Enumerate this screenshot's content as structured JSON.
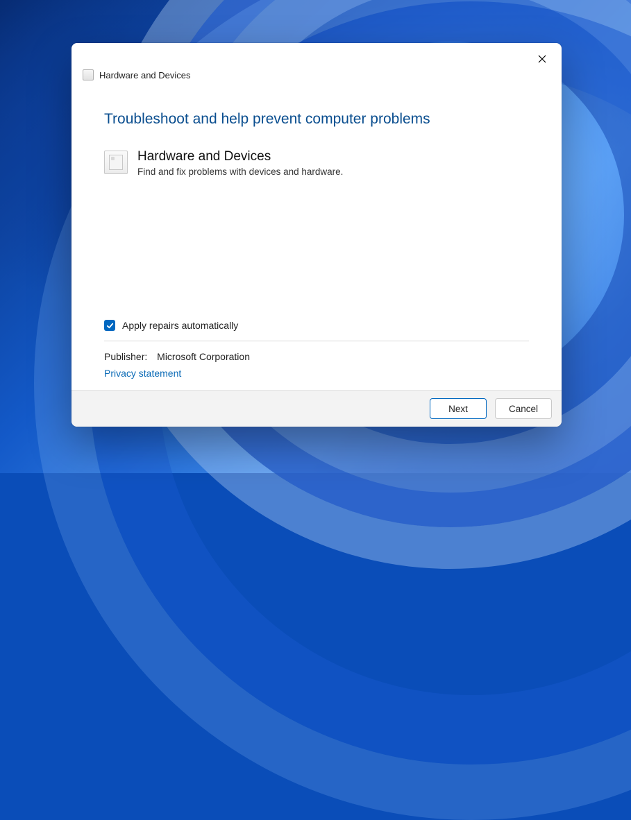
{
  "window": {
    "title": "Hardware and Devices"
  },
  "main": {
    "heading": "Troubleshoot and help prevent computer problems",
    "item": {
      "title": "Hardware and Devices",
      "description": "Find and fix problems with devices and hardware."
    }
  },
  "options": {
    "apply_repairs_label": "Apply repairs automatically",
    "apply_repairs_checked": true
  },
  "meta": {
    "publisher_label": "Publisher:",
    "publisher_value": "Microsoft Corporation",
    "privacy_link": "Privacy statement"
  },
  "footer": {
    "next": "Next",
    "cancel": "Cancel"
  }
}
